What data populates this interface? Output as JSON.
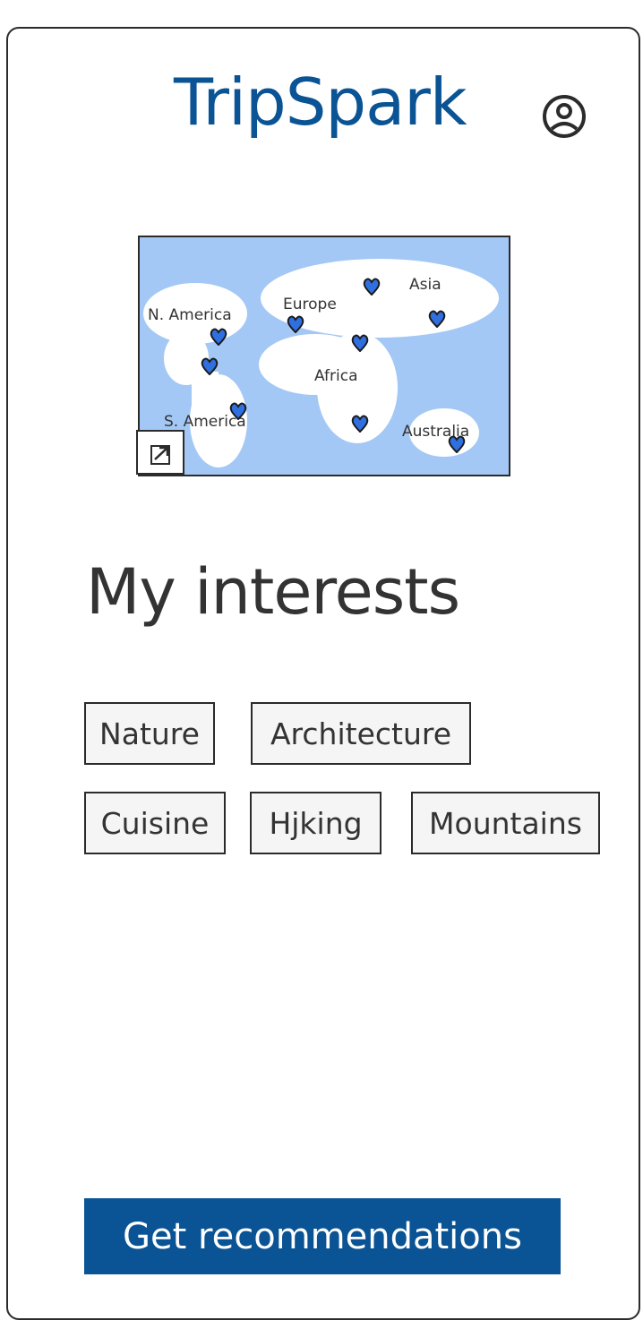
{
  "app": {
    "title": "TripSpark",
    "profile_icon": "user-circle-icon"
  },
  "map": {
    "regions": {
      "north_america": "N. America",
      "south_america": "S. America",
      "europe": "Europe",
      "asia": "Asia",
      "africa": "Africa",
      "australia": "Australia"
    },
    "pin_icon": "map-pin-icon",
    "expand_icon": "expand-arrow-icon",
    "colors": {
      "ocean": "#a4c8f5",
      "land": "#ffffff",
      "pin": "#2f6fe0"
    }
  },
  "interests": {
    "title": "My interests",
    "chips": [
      "Nature",
      "Architecture",
      "Cuisine",
      "Hjking",
      "Mountains"
    ]
  },
  "actions": {
    "recommend_label": "Get recommendations"
  },
  "colors": {
    "brand": "#0a5394",
    "chip_bg": "#f5f5f5"
  }
}
